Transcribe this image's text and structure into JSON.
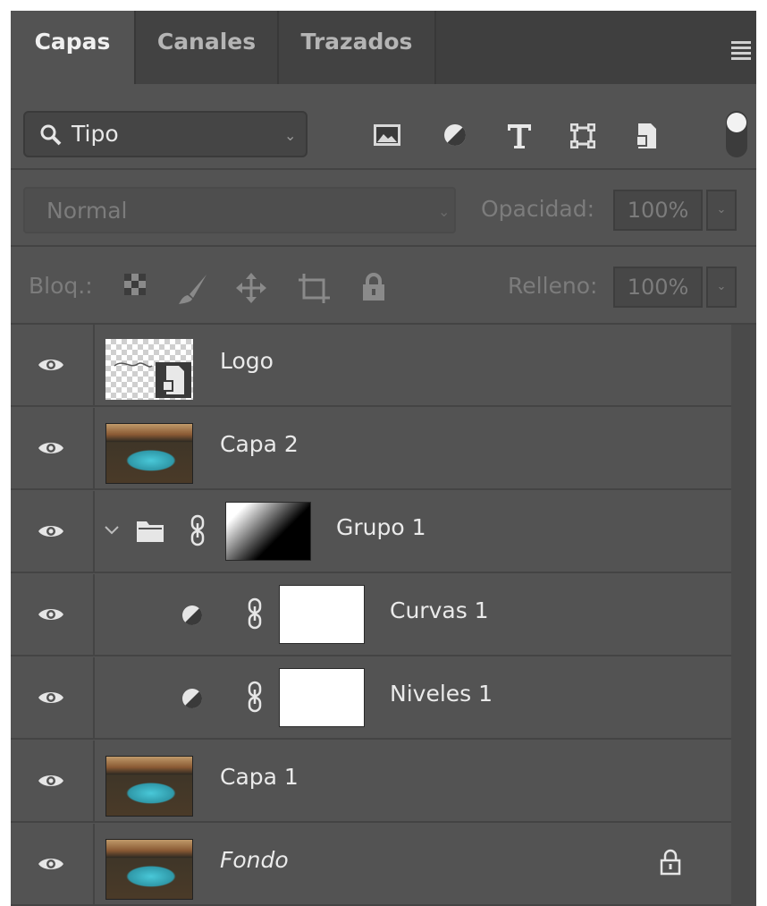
{
  "tabs": [
    {
      "label": "Capas",
      "active": true
    },
    {
      "label": "Canales",
      "active": false
    },
    {
      "label": "Trazados",
      "active": false
    }
  ],
  "filter": {
    "search_value": "Tipo",
    "icons": [
      "image-filter-icon",
      "adjustment-filter-icon",
      "type-filter-icon",
      "shape-filter-icon",
      "smart-object-filter-icon"
    ]
  },
  "blend": {
    "mode": "Normal",
    "opacity_label": "Opacidad:",
    "opacity_value": "100%"
  },
  "lock": {
    "label": "Bloq.:",
    "fill_label": "Relleno:",
    "fill_value": "100%"
  },
  "layers": [
    {
      "name": "Logo",
      "type": "smart-object",
      "visible": true
    },
    {
      "name": "Capa 2",
      "type": "pixel",
      "visible": true
    },
    {
      "name": "Grupo 1",
      "type": "group",
      "expanded": true,
      "visible": true
    },
    {
      "name": "Curvas 1",
      "type": "adjustment",
      "visible": true
    },
    {
      "name": "Niveles 1",
      "type": "adjustment",
      "visible": true
    },
    {
      "name": "Capa 1",
      "type": "pixel",
      "visible": true
    },
    {
      "name": "Fondo",
      "type": "background",
      "locked": true,
      "visible": true
    }
  ],
  "colors": {
    "panel_bg": "#535353",
    "tab_bar_bg": "#3f3f3f",
    "text": "#eaeaea",
    "dim_text": "#7c7c7c"
  }
}
